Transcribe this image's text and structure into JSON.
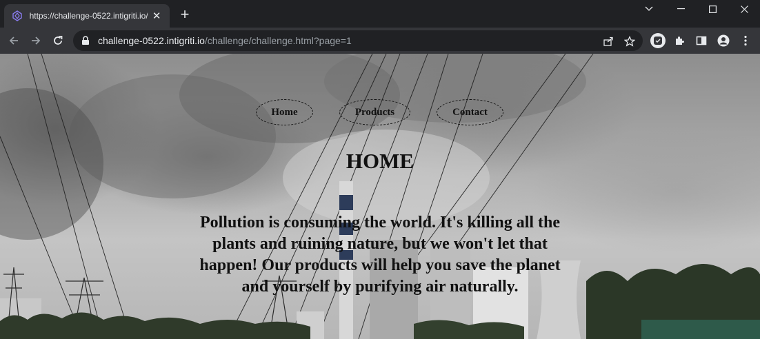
{
  "browser": {
    "tab": {
      "title": "https://challenge-0522.intigriti.io/",
      "favicon": "intigriti-logo-icon"
    },
    "address_bar": {
      "host": "challenge-0522.intigriti.io",
      "path": "/challenge/challenge.html?page=1"
    }
  },
  "page": {
    "nav": [
      {
        "label": "Home"
      },
      {
        "label": "Products"
      },
      {
        "label": "Contact"
      }
    ],
    "heading": "HOME",
    "body_text": "Pollution is consuming the world. It's killing all the plants and ruining nature, but we won't let that happen! Our products will help you save the planet and yourself by purifying air naturally.",
    "background": "industrial-smokestack-photo"
  },
  "colors": {
    "tab_strip": "#202124",
    "toolbar": "#35363a",
    "omnibox": "#202124",
    "text_dark": "#111111"
  }
}
